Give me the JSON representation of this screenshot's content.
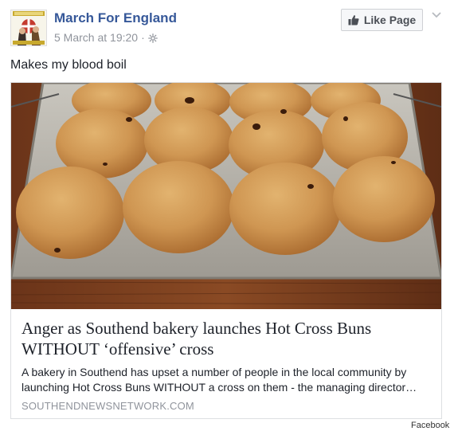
{
  "post": {
    "page_name": "March For England",
    "timestamp": "5 March at 19:20",
    "separator": "·",
    "like_button_label": "Like Page",
    "message": "Makes my blood boil",
    "icons": {
      "audience": "globe-icon",
      "like": "thumbs-up-icon",
      "options": "chevron-down-icon"
    },
    "colors": {
      "name_link": "#365899",
      "meta_text": "#90949c",
      "button_bg": "#f6f7f9"
    }
  },
  "link_preview": {
    "title": "Anger as Southend bakery launches Hot Cross Buns WITHOUT ‘offensive’ cross",
    "description": "A bakery in Southend has upset a number of people in the local community by launching Hot Cross Buns WITHOUT a cross on them - the managing director…",
    "domain": "SOUTHENDNEWSNETWORK.COM"
  },
  "footer": {
    "watermark": "Facebook"
  }
}
